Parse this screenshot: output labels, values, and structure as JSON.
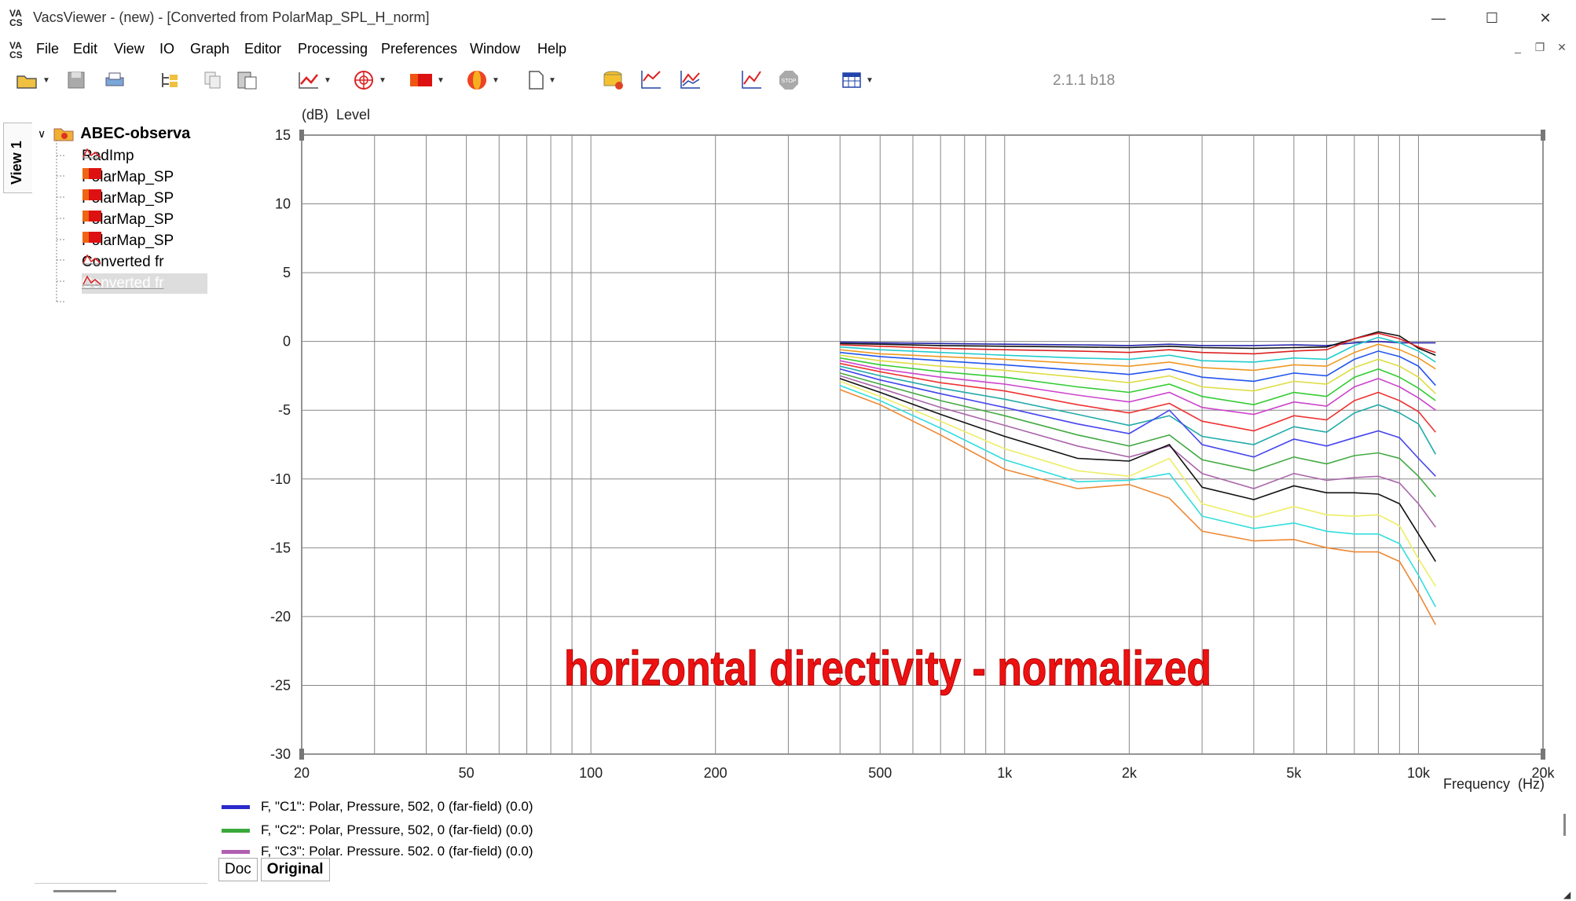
{
  "window": {
    "title": "VacsViewer - (new) - [Converted from PolarMap_SPL_H_norm]",
    "app_icon_text": [
      "VA",
      "CS"
    ],
    "minimize": "—",
    "maximize": "☐",
    "close": "✕"
  },
  "menu": [
    "File",
    "Edit",
    "View",
    "IO",
    "Graph",
    "Editor",
    "Processing",
    "Preferences",
    "Window",
    "Help"
  ],
  "toolbar": {
    "icons": [
      "open-folder-icon",
      "save-icon",
      "print-icon",
      "tree-icon",
      "copy-icon",
      "paste-icon",
      "line-graph-icon",
      "polar-graph-icon",
      "color-map-icon",
      "balloon-icon",
      "new-page-icon",
      "database-icon",
      "graph-xy-icon",
      "graph-overlay-icon",
      "graph-edit-icon",
      "stop-icon",
      "table-icon"
    ],
    "version": "2.1.1 b18"
  },
  "side_tab": "View 1",
  "tree": {
    "root": "ABEC-observa",
    "items": [
      {
        "label": "RadImp",
        "icon": "line-curve-icon"
      },
      {
        "label": "PolarMap_SP",
        "icon": "polarmap-icon"
      },
      {
        "label": "PolarMap_SP",
        "icon": "polarmap-icon"
      },
      {
        "label": "PolarMap_SP",
        "icon": "polarmap-icon"
      },
      {
        "label": "PolarMap_SP",
        "icon": "polarmap-icon"
      },
      {
        "label": "Converted fr",
        "icon": "line-curve-icon"
      },
      {
        "label": "Converted fr",
        "icon": "line-curve-icon",
        "selected": true
      }
    ]
  },
  "legend": [
    {
      "label": "F, \"C1\": Polar, Pressure, 502, 0 (far-field) (0.0)",
      "color": "#2b2bcc"
    },
    {
      "label": "F, \"C2\": Polar, Pressure, 502, 0 (far-field) (0.0)",
      "color": "#3aa83a"
    },
    {
      "label": "F, \"C3\": Polar. Pressure. 502. 0 (far-field) (0.0)",
      "color": "#b060b0"
    }
  ],
  "bottom_tabs": [
    "Doc",
    "Original"
  ],
  "chart_data": {
    "type": "line",
    "ylabel": "(dB)  Level",
    "xlabel": "Frequency  (Hz)",
    "annotation": "horizontal directivity - normalized",
    "xscale": "log",
    "xlim": [
      20,
      20000
    ],
    "ylim": [
      -30,
      15
    ],
    "xticks": [
      20,
      50,
      100,
      200,
      500,
      1000,
      2000,
      5000,
      10000,
      20000
    ],
    "xtick_labels": [
      "20",
      "50",
      "100",
      "200",
      "500",
      "1k",
      "2k",
      "5k",
      "10k",
      "20k"
    ],
    "yticks": [
      15,
      10,
      5,
      0,
      -5,
      -10,
      -15,
      -20,
      -25,
      -30
    ],
    "grid": true,
    "x": [
      400,
      500,
      700,
      1000,
      1500,
      2000,
      2500,
      3000,
      4000,
      5000,
      6000,
      7000,
      8000,
      9000,
      10000,
      11000
    ],
    "series": [
      {
        "color": "#2222aa",
        "values": [
          -0.05,
          -0.1,
          -0.15,
          -0.2,
          -0.25,
          -0.3,
          -0.2,
          -0.3,
          -0.3,
          -0.25,
          -0.3,
          -0.1,
          0.0,
          -0.1,
          -0.1,
          -0.1
        ]
      },
      {
        "color": "#111111",
        "values": [
          -0.15,
          -0.2,
          -0.3,
          -0.35,
          -0.4,
          -0.45,
          -0.35,
          -0.45,
          -0.5,
          -0.45,
          -0.4,
          0.2,
          0.7,
          0.4,
          -0.5,
          -1.0
        ]
      },
      {
        "color": "#dd2222",
        "values": [
          -0.25,
          -0.35,
          -0.5,
          -0.6,
          -0.7,
          -0.8,
          -0.6,
          -0.8,
          -0.9,
          -0.7,
          -0.6,
          0.2,
          0.6,
          0.2,
          -0.4,
          -0.8
        ]
      },
      {
        "color": "#22cccc",
        "values": [
          -0.4,
          -0.6,
          -0.8,
          -1.0,
          -1.2,
          -1.3,
          -1.0,
          -1.4,
          -1.5,
          -1.2,
          -1.3,
          -0.3,
          0.3,
          -0.1,
          -0.7,
          -1.5
        ]
      },
      {
        "color": "#ee9922",
        "values": [
          -0.6,
          -0.9,
          -1.1,
          -1.3,
          -1.6,
          -1.8,
          -1.5,
          -1.9,
          -2.1,
          -1.7,
          -1.8,
          -0.8,
          -0.2,
          -0.6,
          -1.2,
          -2.0
        ]
      },
      {
        "color": "#2255ee",
        "values": [
          -0.8,
          -1.1,
          -1.4,
          -1.7,
          -2.1,
          -2.4,
          -2.0,
          -2.6,
          -2.9,
          -2.3,
          -2.5,
          -1.3,
          -0.7,
          -1.1,
          -1.8,
          -3.2
        ]
      },
      {
        "color": "#dddd44",
        "values": [
          -1.0,
          -1.4,
          -1.8,
          -2.1,
          -2.6,
          -3.0,
          -2.5,
          -3.3,
          -3.6,
          -2.9,
          -3.1,
          -1.9,
          -1.3,
          -1.8,
          -2.6,
          -3.8
        ]
      },
      {
        "color": "#33cc33",
        "values": [
          -1.2,
          -1.7,
          -2.2,
          -2.6,
          -3.3,
          -3.7,
          -3.1,
          -4.0,
          -4.6,
          -3.7,
          -4.0,
          -2.6,
          -2.0,
          -2.6,
          -3.4,
          -4.3
        ]
      },
      {
        "color": "#cc44cc",
        "values": [
          -1.4,
          -2.0,
          -2.6,
          -3.1,
          -3.9,
          -4.4,
          -3.7,
          -4.8,
          -5.3,
          -4.4,
          -4.7,
          -3.3,
          -2.7,
          -3.3,
          -4.1,
          -5.0
        ]
      },
      {
        "color": "#ee3333",
        "values": [
          -1.6,
          -2.2,
          -3.0,
          -3.6,
          -4.6,
          -5.2,
          -4.5,
          -5.8,
          -6.5,
          -5.4,
          -5.7,
          -4.3,
          -3.7,
          -4.3,
          -5.1,
          -6.6
        ]
      },
      {
        "color": "#22aaaa",
        "values": [
          -1.8,
          -2.5,
          -3.4,
          -4.2,
          -5.3,
          -6.1,
          -5.4,
          -6.9,
          -7.5,
          -6.2,
          -6.6,
          -5.2,
          -4.6,
          -5.2,
          -6.0,
          -8.2
        ]
      },
      {
        "color": "#4444ee",
        "values": [
          -2.0,
          -2.8,
          -3.8,
          -4.8,
          -6.0,
          -6.7,
          -5.0,
          -7.5,
          -8.4,
          -7.1,
          -7.6,
          -7.0,
          -6.5,
          -7.0,
          -8.5,
          -9.8
        ]
      },
      {
        "color": "#44aa44",
        "values": [
          -2.3,
          -3.1,
          -4.3,
          -5.4,
          -6.8,
          -7.6,
          -6.8,
          -8.6,
          -9.4,
          -8.4,
          -8.9,
          -8.3,
          -8.1,
          -8.5,
          -9.8,
          -11.3
        ]
      },
      {
        "color": "#aa66aa",
        "values": [
          -2.5,
          -3.4,
          -4.8,
          -6.1,
          -7.6,
          -8.4,
          -7.6,
          -9.6,
          -10.7,
          -9.6,
          -10.1,
          -9.9,
          -9.8,
          -10.3,
          -11.8,
          -13.5
        ]
      },
      {
        "color": "#111111",
        "values": [
          -2.7,
          -3.7,
          -5.3,
          -6.9,
          -8.5,
          -8.7,
          -7.5,
          -10.6,
          -11.5,
          -10.5,
          -11.0,
          -11.0,
          -11.1,
          -11.8,
          -14.0,
          -16.0
        ]
      },
      {
        "color": "#eeee66",
        "values": [
          -2.9,
          -4.0,
          -5.8,
          -7.8,
          -9.4,
          -9.8,
          -8.5,
          -11.8,
          -12.8,
          -12.0,
          -12.6,
          -12.7,
          -12.6,
          -13.4,
          -15.8,
          -17.8
        ]
      },
      {
        "color": "#33dddd",
        "values": [
          -3.2,
          -4.3,
          -6.3,
          -8.6,
          -10.2,
          -10.1,
          -9.6,
          -12.7,
          -13.6,
          -13.2,
          -13.8,
          -14.0,
          -14.0,
          -14.7,
          -17.0,
          -19.3
        ]
      },
      {
        "color": "#ee8833",
        "values": [
          -3.5,
          -4.6,
          -6.8,
          -9.3,
          -10.7,
          -10.4,
          -11.4,
          -13.8,
          -14.5,
          -14.4,
          -15.0,
          -15.3,
          -15.3,
          -16.0,
          -18.3,
          -20.6
        ]
      }
    ]
  }
}
